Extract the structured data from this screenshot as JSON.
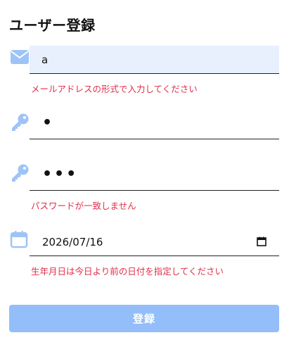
{
  "page": {
    "title": "ユーザー登録"
  },
  "form": {
    "email": {
      "icon": "envelope-icon",
      "value": "a",
      "error": "メールアドレスの形式で入力してください"
    },
    "password": {
      "icon": "key-icon",
      "value": "•"
    },
    "password_confirm": {
      "icon": "key-icon",
      "value": "•••",
      "error": "パスワードが一致しません"
    },
    "birthdate": {
      "icon": "calendar-icon",
      "value": "2026/07/16",
      "error": "生年月日は今日より前の日付を指定してください"
    },
    "submit_label": "登録"
  },
  "colors": {
    "icon": "#9ec3f7",
    "error": "#e22d4a",
    "submit_bg": "#93bef9",
    "autofill_bg": "#e8f0fe"
  }
}
